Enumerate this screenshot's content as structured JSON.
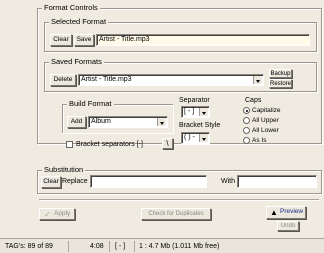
{
  "format_controls": {
    "title": "Format Controls",
    "selected_format": {
      "title": "Selected Format",
      "clear_label": "Clear",
      "save_label": "Save",
      "value": "Artist - Title.mp3"
    },
    "saved_formats": {
      "title": "Saved Formats",
      "delete_label": "Delete",
      "selected": "Artist - Title.mp3",
      "backup_label": "Backup",
      "restore_label": "Restore"
    },
    "build_format": {
      "title": "Build Format",
      "add_label": "Add",
      "field_selected": "Album",
      "bracket_separators_label": "Bracket separators [-]",
      "bracket_separators_checked": false,
      "backslash_label": "\\"
    },
    "separator": {
      "title": "Separator",
      "selected": "[ - ]"
    },
    "bracket_style": {
      "title": "Bracket Style",
      "selected": "( ) -"
    },
    "caps": {
      "title": "Caps",
      "options": [
        "Capitalize",
        "All Upper",
        "All Lower",
        "As Is"
      ],
      "selected": "Capitalize"
    }
  },
  "substitution": {
    "title": "Substitution",
    "clear_label": "Clear",
    "replace_label": "Replace",
    "replace_value": "",
    "with_label": "With",
    "with_value": ""
  },
  "actions": {
    "apply_label": "Apply",
    "check_duplicates_label": "Check for Duplicates",
    "preview_label": "Preview",
    "undo_label": "Undo"
  },
  "status_bar": {
    "tags": "TAG's: 89 of 89",
    "duration": "4:08",
    "separator": "[ - ]",
    "info": "1 : 4.7 Mb  (1.011 Mb free)"
  },
  "icons": {
    "apply": "checkmark-icon",
    "preview": "arrow-up-icon"
  },
  "colors": {
    "window_bg": "#efebe0",
    "input_tint": "#fffbe8",
    "preview_arrow": "#000000",
    "apply_check": "#a9a697"
  }
}
